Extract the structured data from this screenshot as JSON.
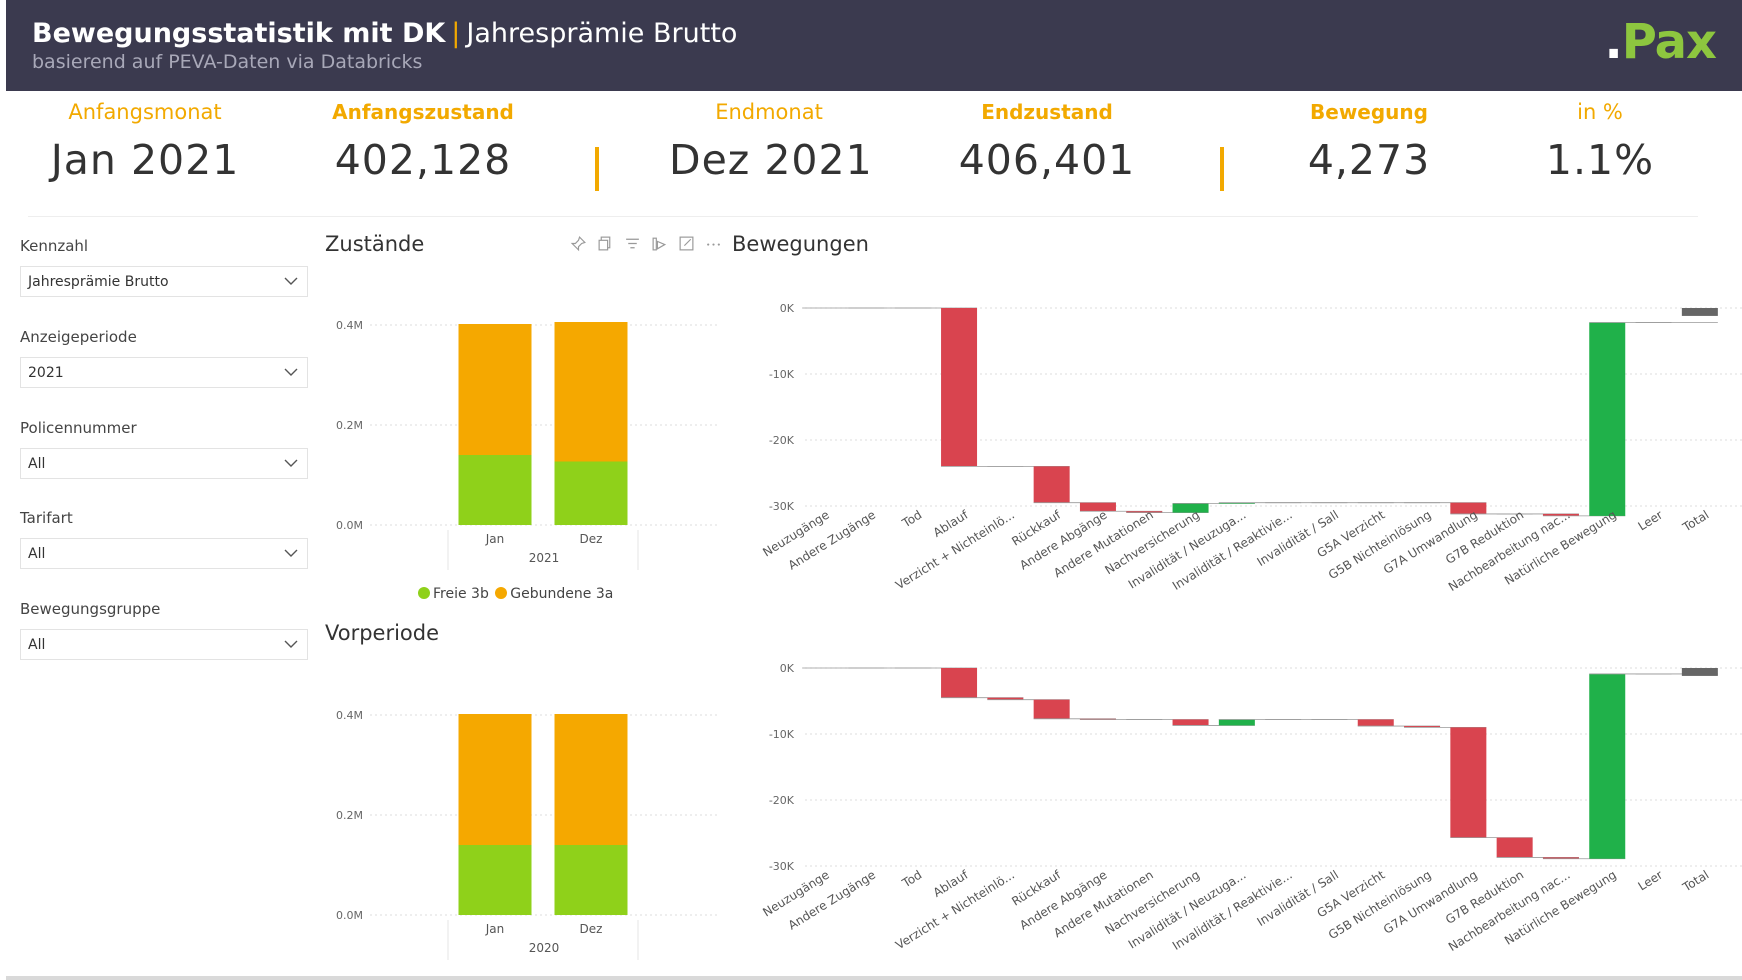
{
  "header": {
    "title": "Bewegungsstatistik mit DK",
    "separator": "|",
    "title_sub": "Jahresprämie Brutto",
    "subtitle": "basierend auf PEVA-Daten via Databricks",
    "logo_dot": ".",
    "logo_text": "Pax"
  },
  "kpis": {
    "anfangsmonat": {
      "label": "Anfangsmonat",
      "value": "Jan 2021"
    },
    "anfangszustand": {
      "label": "Anfangszustand",
      "value": "402,128"
    },
    "endmonat": {
      "label": "Endmonat",
      "value": "Dez 2021"
    },
    "endzustand": {
      "label": "Endzustand",
      "value": "406,401"
    },
    "bewegung": {
      "label": "Bewegung",
      "value": "4,273"
    },
    "prozent": {
      "label": "in %",
      "value": "1.1%"
    }
  },
  "slicers": {
    "kennzahl": {
      "label": "Kennzahl",
      "value": "Jahresprämie Brutto"
    },
    "anzeigeperiode": {
      "label": "Anzeigeperiode",
      "value": "2021"
    },
    "policennummer": {
      "label": "Policennummer",
      "value": "All"
    },
    "tarifart": {
      "label": "Tarifart",
      "value": "All"
    },
    "bewegungsgruppe": {
      "label": "Bewegungsgruppe",
      "value": "All"
    }
  },
  "panels": {
    "zustaende": "Zustände",
    "vorperiode": "Vorperiode",
    "bewegungen": "Bewegungen"
  },
  "toolbar_icons": [
    "pin-icon",
    "copy-icon",
    "filter-icon",
    "spotlight-icon",
    "focus-mode-icon",
    "more-options-icon"
  ],
  "colors": {
    "header_bg": "#3b3a4f",
    "accent": "#f2a900",
    "freie": "#8fd11a",
    "gebundene": "#f5a800",
    "decrease": "#d9444f",
    "increase": "#20b14a",
    "total": "#666666",
    "logo": "#8dc63f"
  },
  "legend": [
    {
      "name": "Freie 3b",
      "color": "#8fd11a"
    },
    {
      "name": "Gebundene 3a",
      "color": "#f5a800"
    }
  ],
  "chart_data": [
    {
      "id": "zustaende",
      "type": "bar",
      "stacked": true,
      "title": "Zustände",
      "categories": [
        "Jan",
        "Dez"
      ],
      "group_label": "2021",
      "series": [
        {
          "name": "Freie 3b",
          "values": [
            0.14,
            0.127
          ]
        },
        {
          "name": "Gebundene 3a",
          "values": [
            0.262,
            0.279
          ]
        }
      ],
      "yticks": [
        "0.0M",
        "0.2M",
        "0.4M"
      ],
      "ylim": [
        0,
        0.4
      ],
      "grid": true,
      "legend_position": "bottom"
    },
    {
      "id": "vorperiode",
      "type": "bar",
      "stacked": true,
      "title": "Vorperiode",
      "categories": [
        "Jan",
        "Dez"
      ],
      "group_label": "2020",
      "series": [
        {
          "name": "Freie 3b",
          "values": [
            0.14,
            0.14
          ]
        },
        {
          "name": "Gebundene 3a",
          "values": [
            0.262,
            0.262
          ]
        }
      ],
      "yticks": [
        "0.0M",
        "0.2M",
        "0.4M"
      ],
      "ylim": [
        0,
        0.4
      ],
      "grid": true
    },
    {
      "id": "bewegungen",
      "type": "waterfall",
      "title": "Bewegungen",
      "categories": [
        "Neuzugänge",
        "Andere Zugänge",
        "Tod",
        "Ablauf",
        "Verzicht + Nichteinlö...",
        "Rückkauf",
        "Andere Abgänge",
        "Andere Mutationen",
        "Nachversicherung",
        "Invalidität / Neuzuga...",
        "Invalidität / Reaktivie...",
        "Invalidität / Sall",
        "G5A Verzicht",
        "G5B Nichteinlösung",
        "G7A Umwandlung",
        "G7B Reduktion",
        "Nachbearbeitung nac...",
        "Natürliche Bewegung",
        "Leer",
        "Total"
      ],
      "values": [
        0,
        0,
        0,
        -24000,
        0,
        -5500,
        -1300,
        -200,
        1400,
        100,
        0,
        0,
        0,
        0,
        -1700,
        0,
        -300,
        29300,
        0,
        -1200
      ],
      "yticks": [
        "0K",
        "-10K",
        "-20K",
        "-30K"
      ],
      "ylim": [
        -30000,
        1500
      ],
      "grid": true
    },
    {
      "id": "bewegungen-vorperiode",
      "type": "waterfall",
      "categories": [
        "Neuzugänge",
        "Andere Zugänge",
        "Tod",
        "Ablauf",
        "Verzicht + Nichteinlö...",
        "Rückkauf",
        "Andere Abgänge",
        "Andere Mutationen",
        "Nachversicherung",
        "Invalidität / Neuzuga...",
        "Invalidität / Reaktivie...",
        "Invalidität / Sall",
        "G5A Verzicht",
        "G5B Nichteinlösung",
        "G7A Umwandlung",
        "G7B Reduktion",
        "Nachbearbeitung nac...",
        "Natürliche Bewegung",
        "Leer",
        "Total"
      ],
      "values": [
        0,
        0,
        0,
        -4500,
        -300,
        -2900,
        -100,
        0,
        -900,
        900,
        0,
        0,
        -1000,
        -200,
        -16700,
        -3000,
        -200,
        28000,
        0,
        -1200
      ],
      "yticks": [
        "0K",
        "-10K",
        "-20K",
        "-30K"
      ],
      "ylim": [
        -30000,
        1500
      ],
      "grid": true
    }
  ]
}
